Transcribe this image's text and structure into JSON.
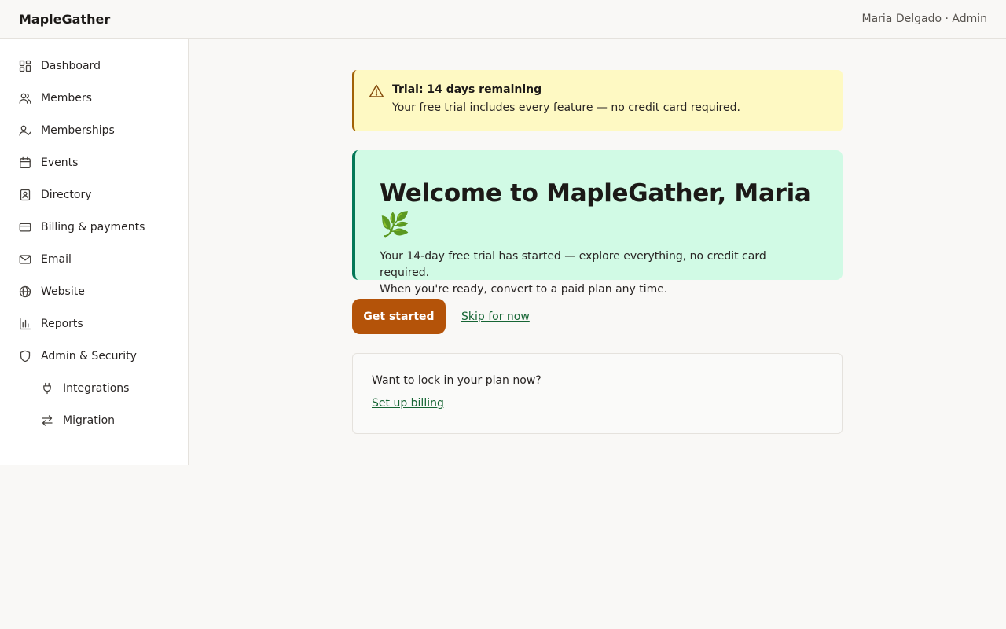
{
  "header": {
    "brand": "MapleGather",
    "user": "Maria Delgado · Admin"
  },
  "sidebar": {
    "items": [
      {
        "label": "Dashboard",
        "icon": "grid-icon"
      },
      {
        "label": "Members",
        "icon": "users-icon"
      },
      {
        "label": "Memberships",
        "icon": "user-check-icon"
      },
      {
        "label": "Events",
        "icon": "calendar-icon"
      },
      {
        "label": "Directory",
        "icon": "contact-book-icon"
      },
      {
        "label": "Billing & payments",
        "icon": "credit-card-icon"
      },
      {
        "label": "Email",
        "icon": "mail-icon"
      },
      {
        "label": "Website",
        "icon": "globe-icon"
      },
      {
        "label": "Reports",
        "icon": "bar-chart-icon"
      },
      {
        "label": "Admin & Security",
        "icon": "shield-icon"
      },
      {
        "label": "Integrations",
        "icon": "plug-icon"
      },
      {
        "label": "Migration",
        "icon": "arrows-swap-icon"
      }
    ]
  },
  "alert": {
    "icon": "warning-triangle-icon",
    "title": "Trial: 14 days remaining",
    "body": "Your free trial includes every feature — no credit card required."
  },
  "welcome": {
    "title": "Welcome to MapleGather, Maria 🌿",
    "line1": "Your 14-day free trial has started — explore everything, no credit card required.",
    "line2": "When you're ready, convert to a paid plan any time."
  },
  "actions": {
    "primary": "Get started",
    "skip": "Skip for now"
  },
  "billing": {
    "question": "Want to lock in your plan now?",
    "link": "Set up billing"
  },
  "colors": {
    "accent_button": "#b45309",
    "alert_bg": "#fef9c3",
    "welcome_bg": "#d1fae5",
    "link": "#166534"
  }
}
